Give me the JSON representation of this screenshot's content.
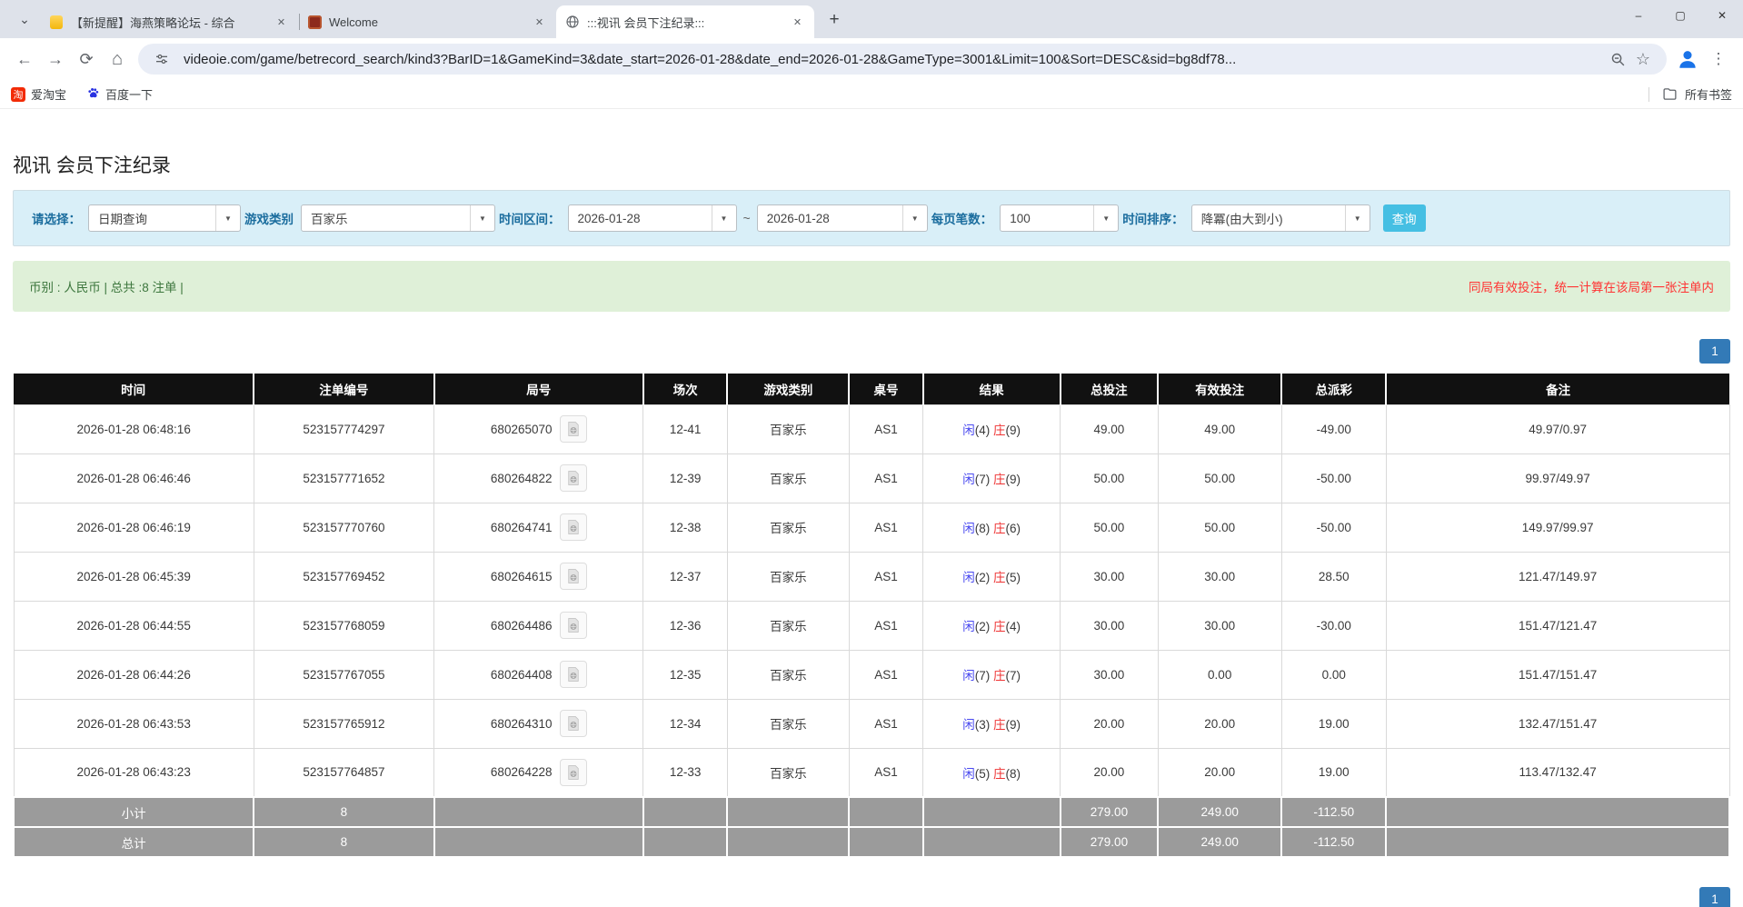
{
  "browser": {
    "tabs": [
      {
        "title": "【新提醒】海燕策略论坛 - 综合",
        "favicon": "yellow-doc",
        "active": false
      },
      {
        "title": "Welcome",
        "favicon": "red-ornament",
        "active": false
      },
      {
        "title": ":::视讯 会员下注纪录:::",
        "favicon": "globe",
        "active": true
      }
    ],
    "window_controls": {
      "minimize": "–",
      "maximize": "▢",
      "close": "✕"
    },
    "nav": {
      "back": "←",
      "forward": "→",
      "reload": "⟳",
      "home": "⌂",
      "star": "☆",
      "kebab": "⋮"
    },
    "address": {
      "url": "videoie.com/game/betrecord_search/kind3?BarID=1&GameKind=3&date_start=2026-01-28&date_end=2026-01-28&GameType=3001&Limit=100&Sort=DESC&sid=bg8df78..."
    },
    "bookmarks_bar": {
      "items": [
        {
          "label": "爱淘宝",
          "icon": "taobao"
        },
        {
          "label": "百度一下",
          "icon": "baidu-paw"
        }
      ],
      "all_bookmarks": "所有书签"
    }
  },
  "page": {
    "title": "视讯 会员下注纪录",
    "filter": {
      "select_label": "请选择：",
      "select_value": "日期查询",
      "game_label": "游戏类别",
      "game_value": "百家乐",
      "range_label": "时间区间：",
      "date_start": "2026-01-28",
      "range_sep": "~",
      "date_end": "2026-01-28",
      "limit_label": "每页笔数：",
      "limit_value": "100",
      "sort_label": "时间排序：",
      "sort_value": "降冪(由大到小)",
      "query_button": "查询"
    },
    "summary_bar": {
      "left": "币别 : 人民币 | 总共 :8 注单 |",
      "right": "同局有效投注，统一计算在该局第一张注单内"
    },
    "pagination": {
      "page": "1"
    },
    "table": {
      "headers": [
        "时间",
        "注单编号",
        "局号",
        "场次",
        "游戏类别",
        "桌号",
        "结果",
        "总投注",
        "有效投注",
        "总派彩",
        "备注"
      ],
      "rows": [
        {
          "time": "2026-01-28 06:48:16",
          "bet_no": "523157774297",
          "round_no": "680265070",
          "session": "12-41",
          "game": "百家乐",
          "table_no": "AS1",
          "player": "闲",
          "player_n": "(4)",
          "banker": "庄",
          "banker_n": "(9)",
          "total_bet": "49.00",
          "valid_bet": "49.00",
          "payout": "-49.00",
          "note": "49.97/0.97"
        },
        {
          "time": "2026-01-28 06:46:46",
          "bet_no": "523157771652",
          "round_no": "680264822",
          "session": "12-39",
          "game": "百家乐",
          "table_no": "AS1",
          "player": "闲",
          "player_n": "(7)",
          "banker": "庄",
          "banker_n": "(9)",
          "total_bet": "50.00",
          "valid_bet": "50.00",
          "payout": "-50.00",
          "note": "99.97/49.97"
        },
        {
          "time": "2026-01-28 06:46:19",
          "bet_no": "523157770760",
          "round_no": "680264741",
          "session": "12-38",
          "game": "百家乐",
          "table_no": "AS1",
          "player": "闲",
          "player_n": "(8)",
          "banker": "庄",
          "banker_n": "(6)",
          "total_bet": "50.00",
          "valid_bet": "50.00",
          "payout": "-50.00",
          "note": "149.97/99.97"
        },
        {
          "time": "2026-01-28 06:45:39",
          "bet_no": "523157769452",
          "round_no": "680264615",
          "session": "12-37",
          "game": "百家乐",
          "table_no": "AS1",
          "player": "闲",
          "player_n": "(2)",
          "banker": "庄",
          "banker_n": "(5)",
          "total_bet": "30.00",
          "valid_bet": "30.00",
          "payout": "28.50",
          "note": "121.47/149.97"
        },
        {
          "time": "2026-01-28 06:44:55",
          "bet_no": "523157768059",
          "round_no": "680264486",
          "session": "12-36",
          "game": "百家乐",
          "table_no": "AS1",
          "player": "闲",
          "player_n": "(2)",
          "banker": "庄",
          "banker_n": "(4)",
          "total_bet": "30.00",
          "valid_bet": "30.00",
          "payout": "-30.00",
          "note": "151.47/121.47"
        },
        {
          "time": "2026-01-28 06:44:26",
          "bet_no": "523157767055",
          "round_no": "680264408",
          "session": "12-35",
          "game": "百家乐",
          "table_no": "AS1",
          "player": "闲",
          "player_n": "(7)",
          "banker": "庄",
          "banker_n": "(7)",
          "total_bet": "30.00",
          "valid_bet": "0.00",
          "payout": "0.00",
          "note": "151.47/151.47"
        },
        {
          "time": "2026-01-28 06:43:53",
          "bet_no": "523157765912",
          "round_no": "680264310",
          "session": "12-34",
          "game": "百家乐",
          "table_no": "AS1",
          "player": "闲",
          "player_n": "(3)",
          "banker": "庄",
          "banker_n": "(9)",
          "total_bet": "20.00",
          "valid_bet": "20.00",
          "payout": "19.00",
          "note": "132.47/151.47"
        },
        {
          "time": "2026-01-28 06:43:23",
          "bet_no": "523157764857",
          "round_no": "680264228",
          "session": "12-33",
          "game": "百家乐",
          "table_no": "AS1",
          "player": "闲",
          "player_n": "(5)",
          "banker": "庄",
          "banker_n": "(8)",
          "total_bet": "20.00",
          "valid_bet": "20.00",
          "payout": "19.00",
          "note": "113.47/132.47"
        }
      ],
      "subtotal_row": {
        "label": "小计",
        "count": "8",
        "total_bet": "279.00",
        "valid_bet": "249.00",
        "payout": "-112.50"
      },
      "total_row": {
        "label": "总计",
        "count": "8",
        "total_bet": "279.00",
        "valid_bet": "249.00",
        "payout": "-112.50"
      }
    },
    "colors": {
      "accent_query": "#45bfe3",
      "pager_blue": "#337ab7",
      "player_blue": "#4a4af0",
      "banker_red": "#ee3333",
      "bet_blue": "#3578e5",
      "negative_red": "#ee2c2c",
      "summary_green_bg": "#dff0d8",
      "filter_bg": "#d9eff8",
      "header_black": "#111111",
      "sum_gray": "#9b9b9b"
    }
  }
}
